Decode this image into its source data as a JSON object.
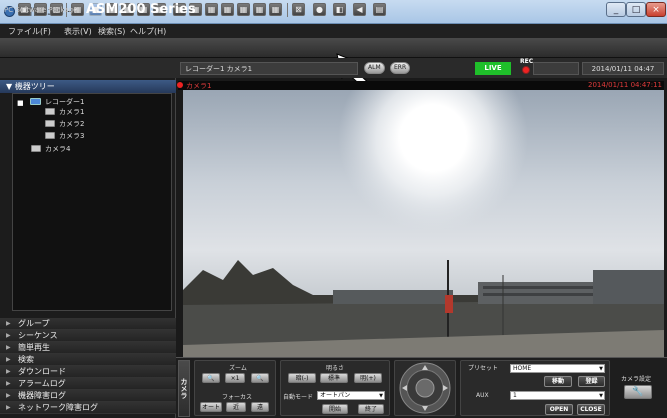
{
  "window": {
    "title": "操作モニター",
    "min": "_",
    "max": "□",
    "close": "×"
  },
  "menu": [
    "ファイル(F)",
    "表示(V)",
    "検索(S)",
    "ヘルプ(H)"
  ],
  "header": {
    "brand_small": "PC Software Package",
    "brand_big": "ASM200 Series",
    "camera_path": "レコーダー1 カメラ1",
    "alm": "ALM",
    "err": "ERR",
    "live": "LIVE",
    "rec": "REC",
    "datetime": "2014/01/11 04:47"
  },
  "tree": {
    "title": "機器ツリー",
    "recorder": "レコーダー1",
    "cameras": [
      "カメラ1",
      "カメラ2",
      "カメラ3"
    ],
    "camera4": "カメラ4"
  },
  "nav": [
    "グループ",
    "シーケンス",
    "簡単再生",
    "検索",
    "ダウンロード",
    "アラームログ",
    "機器障害ログ",
    "ネットワーク障害ログ"
  ],
  "camera_view": {
    "name": "カメラ1",
    "timestamp": "2014/01/11 04:47:11"
  },
  "controls": {
    "tab_label": "カメラ",
    "zoom": {
      "label": "ズーム",
      "buttons": [
        "🔍",
        "×1",
        "🔍"
      ]
    },
    "focus": {
      "label": "フォーカス",
      "buttons": [
        "オート",
        "近",
        "遠"
      ]
    },
    "brightness": {
      "label": "明るさ",
      "buttons": [
        "暗(-)",
        "標準",
        "明(+)"
      ]
    },
    "auto_mode": {
      "label": "自動モード",
      "value": "オートパン",
      "start": "開始",
      "stop": "終了"
    },
    "preset": {
      "label": "プリセット",
      "value": "HOME",
      "move": "移動",
      "register": "登録"
    },
    "aux": {
      "label": "AUX",
      "value": "1",
      "open": "OPEN",
      "close": "CLOSE"
    },
    "camera_settings": "カメラ設定"
  },
  "colors": {
    "live": "#1fbf2a",
    "timestamp": "#e03b3b",
    "tree_header": "#3d5a85"
  }
}
